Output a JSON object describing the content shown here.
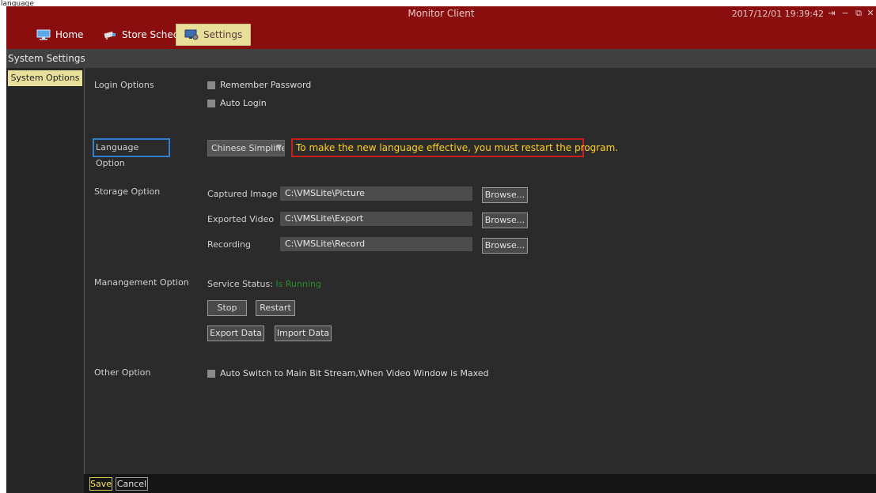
{
  "corner_label": "language",
  "window": {
    "title": "Monitor Client",
    "datetime": "2017/12/01 19:39:42",
    "controls": {
      "logout": "⇥",
      "minimize": "−",
      "restore": "⧉",
      "close": "✕"
    }
  },
  "nav": {
    "tabs": [
      {
        "label": "Home",
        "icon": "monitor-icon"
      },
      {
        "label": "Store Sched",
        "icon": "camera-icon"
      },
      {
        "label": "Settings",
        "icon": "settings-monitor-icon",
        "active": true
      }
    ]
  },
  "subheader": {
    "label": "System Settings"
  },
  "sidebar": {
    "items": [
      {
        "label": "System Options",
        "active": true
      }
    ]
  },
  "login": {
    "label": "Login Options",
    "remember": "Remember Password",
    "auto_login": "Auto Login"
  },
  "language": {
    "label": "Language Option",
    "selected": "Chinese Simplified",
    "warning": "To make the new language effective, you must restart the program."
  },
  "storage": {
    "label": "Storage Option",
    "rows": [
      {
        "label": "Captured Image",
        "path": "C:\\VMSLite\\Picture",
        "button": "Browse..."
      },
      {
        "label": "Exported Video",
        "path": "C:\\VMSLite\\Export",
        "button": "Browse..."
      },
      {
        "label": "Recording",
        "path": "C:\\VMSLite\\Record",
        "button": "Browse..."
      }
    ]
  },
  "management": {
    "label": "Manangement Option",
    "status_label": "Service Status:",
    "status_value": "Is Running",
    "stop": "Stop",
    "restart": "Restart",
    "export": "Export Data",
    "import": "Import Data"
  },
  "other": {
    "label": "Other Option",
    "auto_switch": "Auto Switch to Main Bit Stream,When Video Window is Maxed"
  },
  "footer": {
    "save": "Save",
    "cancel": "Cancel"
  },
  "colors": {
    "titlebar": "#8b0e0e",
    "active_tab": "#e8e09a",
    "warning_border": "#c81e1e",
    "warning_text": "#ffd21a",
    "focus_border": "#2f7fd4",
    "status_green": "#2c8a2c"
  }
}
